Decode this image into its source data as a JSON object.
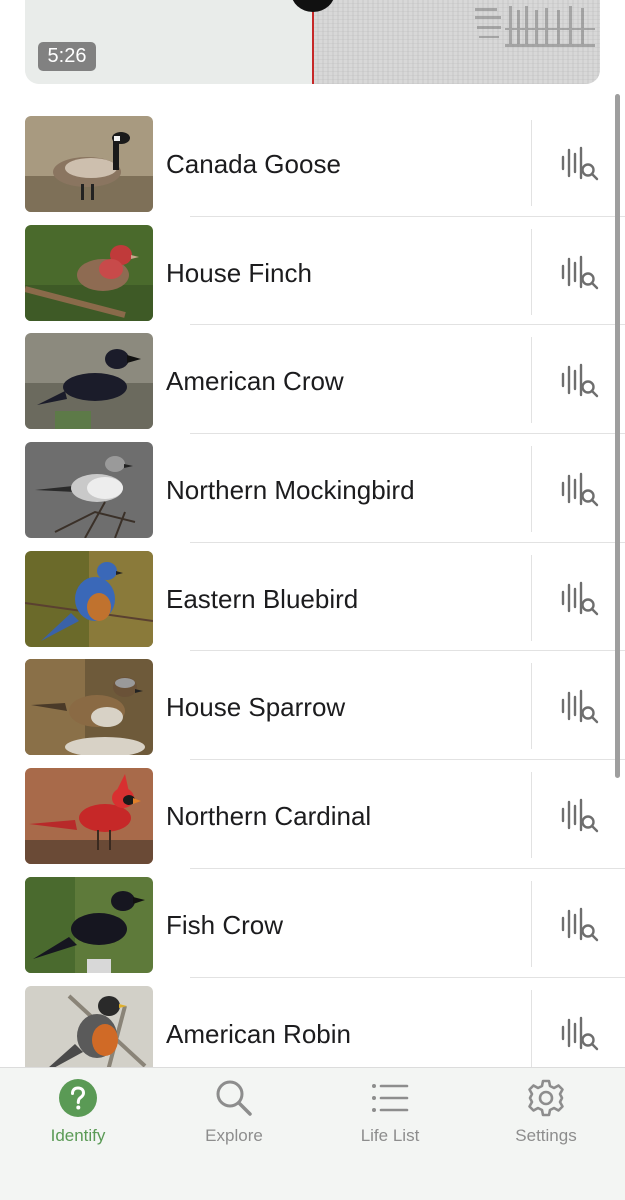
{
  "player": {
    "time": "5:26"
  },
  "birds": [
    {
      "name": "Canada Goose",
      "photo": "canada-goose-photo"
    },
    {
      "name": "House Finch",
      "photo": "house-finch-photo"
    },
    {
      "name": "American Crow",
      "photo": "american-crow-photo"
    },
    {
      "name": "Northern Mockingbird",
      "photo": "northern-mockingbird-photo"
    },
    {
      "name": "Eastern Bluebird",
      "photo": "eastern-bluebird-photo"
    },
    {
      "name": "House Sparrow",
      "photo": "house-sparrow-photo"
    },
    {
      "name": "Northern Cardinal",
      "photo": "northern-cardinal-photo"
    },
    {
      "name": "Fish Crow",
      "photo": "fish-crow-photo"
    },
    {
      "name": "American Robin",
      "photo": "american-robin-photo"
    }
  ],
  "row_action_icon": "sound-search-icon",
  "tabs": [
    {
      "label": "Identify",
      "icon": "question-mark-icon",
      "active": true
    },
    {
      "label": "Explore",
      "icon": "magnifier-icon",
      "active": false
    },
    {
      "label": "Life List",
      "icon": "list-icon",
      "active": false
    },
    {
      "label": "Settings",
      "icon": "gear-icon",
      "active": false
    }
  ],
  "colors": {
    "accent": "#5a9a55",
    "playhead": "#c62828",
    "text": "#1c1c1e",
    "muted": "#8d8d8d"
  }
}
